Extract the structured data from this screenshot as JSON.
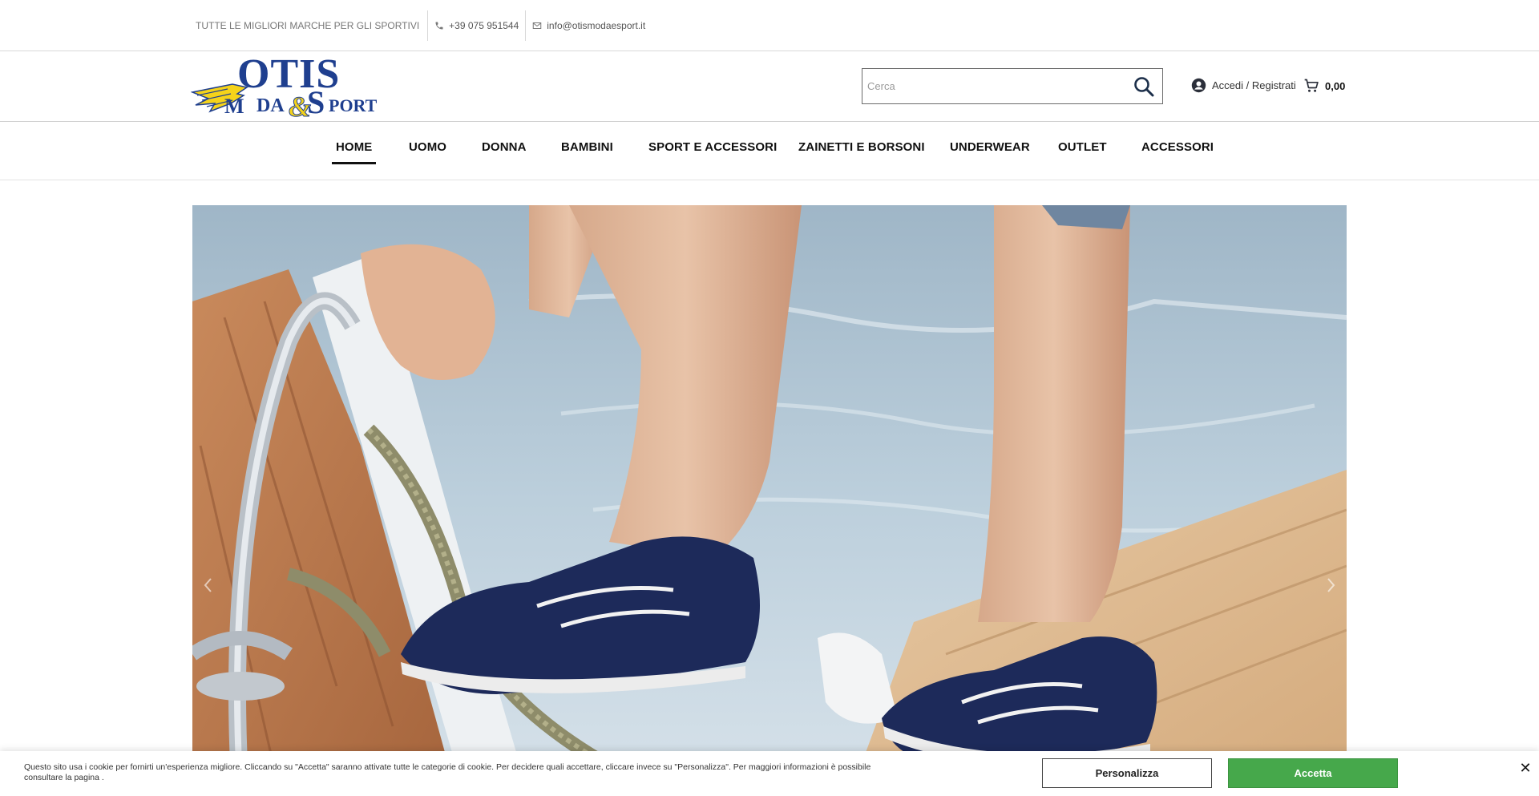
{
  "topbar": {
    "tagline": "TUTTE LE MIGLIORI MARCHE PER GLI SPORTIVI",
    "phone": "+39 075 951544",
    "email": "info@otismodaesport.it",
    "phone_icon": "phone-icon",
    "email_icon": "mail-icon"
  },
  "header": {
    "logo_text_main": "OTIS",
    "logo_text_moda": "MODA",
    "logo_text_sport": "SPORT",
    "search_placeholder": "Cerca",
    "account_label": "Accedi / Registrati",
    "cart_total": "0,00"
  },
  "nav": {
    "items": [
      {
        "label": "HOME",
        "active": true
      },
      {
        "label": "UOMO"
      },
      {
        "label": "DONNA"
      },
      {
        "label": "BAMBINI"
      },
      {
        "label": "SPORT E ACCESSORI"
      },
      {
        "label": "ZAINETTI E BORSONI"
      },
      {
        "label": "UNDERWEAR"
      },
      {
        "label": "OUTLET"
      },
      {
        "label": "ACCESSORI"
      }
    ]
  },
  "cookie": {
    "text": "Questo sito usa i cookie per fornirti un'esperienza migliore. Cliccando su \"Accetta\" saranno attivate tutte le categorie di cookie. Per decidere quali accettare, cliccare invece su \"Personalizza\". Per maggiori informazioni è possibile consultare la pagina .",
    "customize_label": "Personalizza",
    "accept_label": "Accetta",
    "close_symbol": "✕"
  },
  "colors": {
    "logo_blue": "#1f3f8f",
    "logo_yellow": "#f5d31a",
    "accept_green": "#46a84b"
  }
}
